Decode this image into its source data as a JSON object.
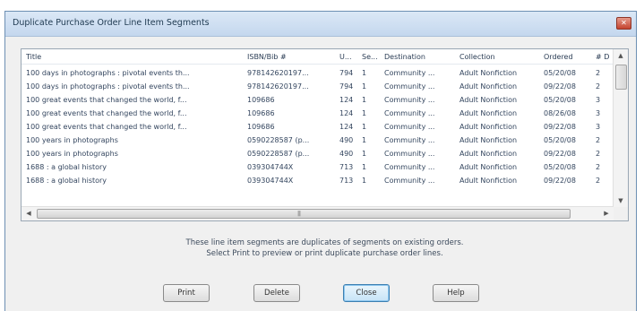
{
  "dialog": {
    "title": "Duplicate Purchase Order Line Item Segments",
    "close_icon": "close-icon"
  },
  "table": {
    "columns": [
      {
        "key": "title",
        "label": "Title"
      },
      {
        "key": "isbn",
        "label": "ISBN/Bib #"
      },
      {
        "key": "u",
        "label": "U..."
      },
      {
        "key": "se",
        "label": "Se..."
      },
      {
        "key": "destination",
        "label": "Destination"
      },
      {
        "key": "collection",
        "label": "Collection"
      },
      {
        "key": "ordered",
        "label": "Ordered"
      },
      {
        "key": "num",
        "label": "# D"
      }
    ],
    "rows": [
      {
        "title": "100 days in photographs : pivotal events th...",
        "isbn": "978142620197...",
        "u": "794",
        "se": "1",
        "destination": "Community ...",
        "collection": "Adult Nonfiction",
        "ordered": "05/20/08",
        "num": "2"
      },
      {
        "title": "100 days in photographs : pivotal events th...",
        "isbn": "978142620197...",
        "u": "794",
        "se": "1",
        "destination": "Community ...",
        "collection": "Adult Nonfiction",
        "ordered": "09/22/08",
        "num": "2"
      },
      {
        "title": "100 great events that changed the world, f...",
        "isbn": "109686",
        "u": "124",
        "se": "1",
        "destination": "Community ...",
        "collection": "Adult Nonfiction",
        "ordered": "05/20/08",
        "num": "3"
      },
      {
        "title": "100 great events that changed the world, f...",
        "isbn": "109686",
        "u": "124",
        "se": "1",
        "destination": "Community ...",
        "collection": "Adult Nonfiction",
        "ordered": "08/26/08",
        "num": "3"
      },
      {
        "title": "100 great events that changed the world, f...",
        "isbn": "109686",
        "u": "124",
        "se": "1",
        "destination": "Community ...",
        "collection": "Adult Nonfiction",
        "ordered": "09/22/08",
        "num": "3"
      },
      {
        "title": "100 years in photographs",
        "isbn": "0590228587 (p...",
        "u": "490",
        "se": "1",
        "destination": "Community ...",
        "collection": "Adult Nonfiction",
        "ordered": "05/20/08",
        "num": "2"
      },
      {
        "title": "100 years in photographs",
        "isbn": "0590228587 (p...",
        "u": "490",
        "se": "1",
        "destination": "Community ...",
        "collection": "Adult Nonfiction",
        "ordered": "09/22/08",
        "num": "2"
      },
      {
        "title": "1688 : a global history",
        "isbn": "039304744X",
        "u": "713",
        "se": "1",
        "destination": "Community ...",
        "collection": "Adult Nonfiction",
        "ordered": "05/20/08",
        "num": "2"
      },
      {
        "title": "1688 : a global history",
        "isbn": "039304744X",
        "u": "713",
        "se": "1",
        "destination": "Community ...",
        "collection": "Adult Nonfiction",
        "ordered": "09/22/08",
        "num": "2"
      }
    ]
  },
  "message": {
    "line1": "These line item segments are duplicates of segments on existing orders.",
    "line2": "Select Print to preview or print duplicate purchase order lines."
  },
  "buttons": {
    "print": "Print",
    "delete": "Delete",
    "close": "Close",
    "help": "Help"
  }
}
